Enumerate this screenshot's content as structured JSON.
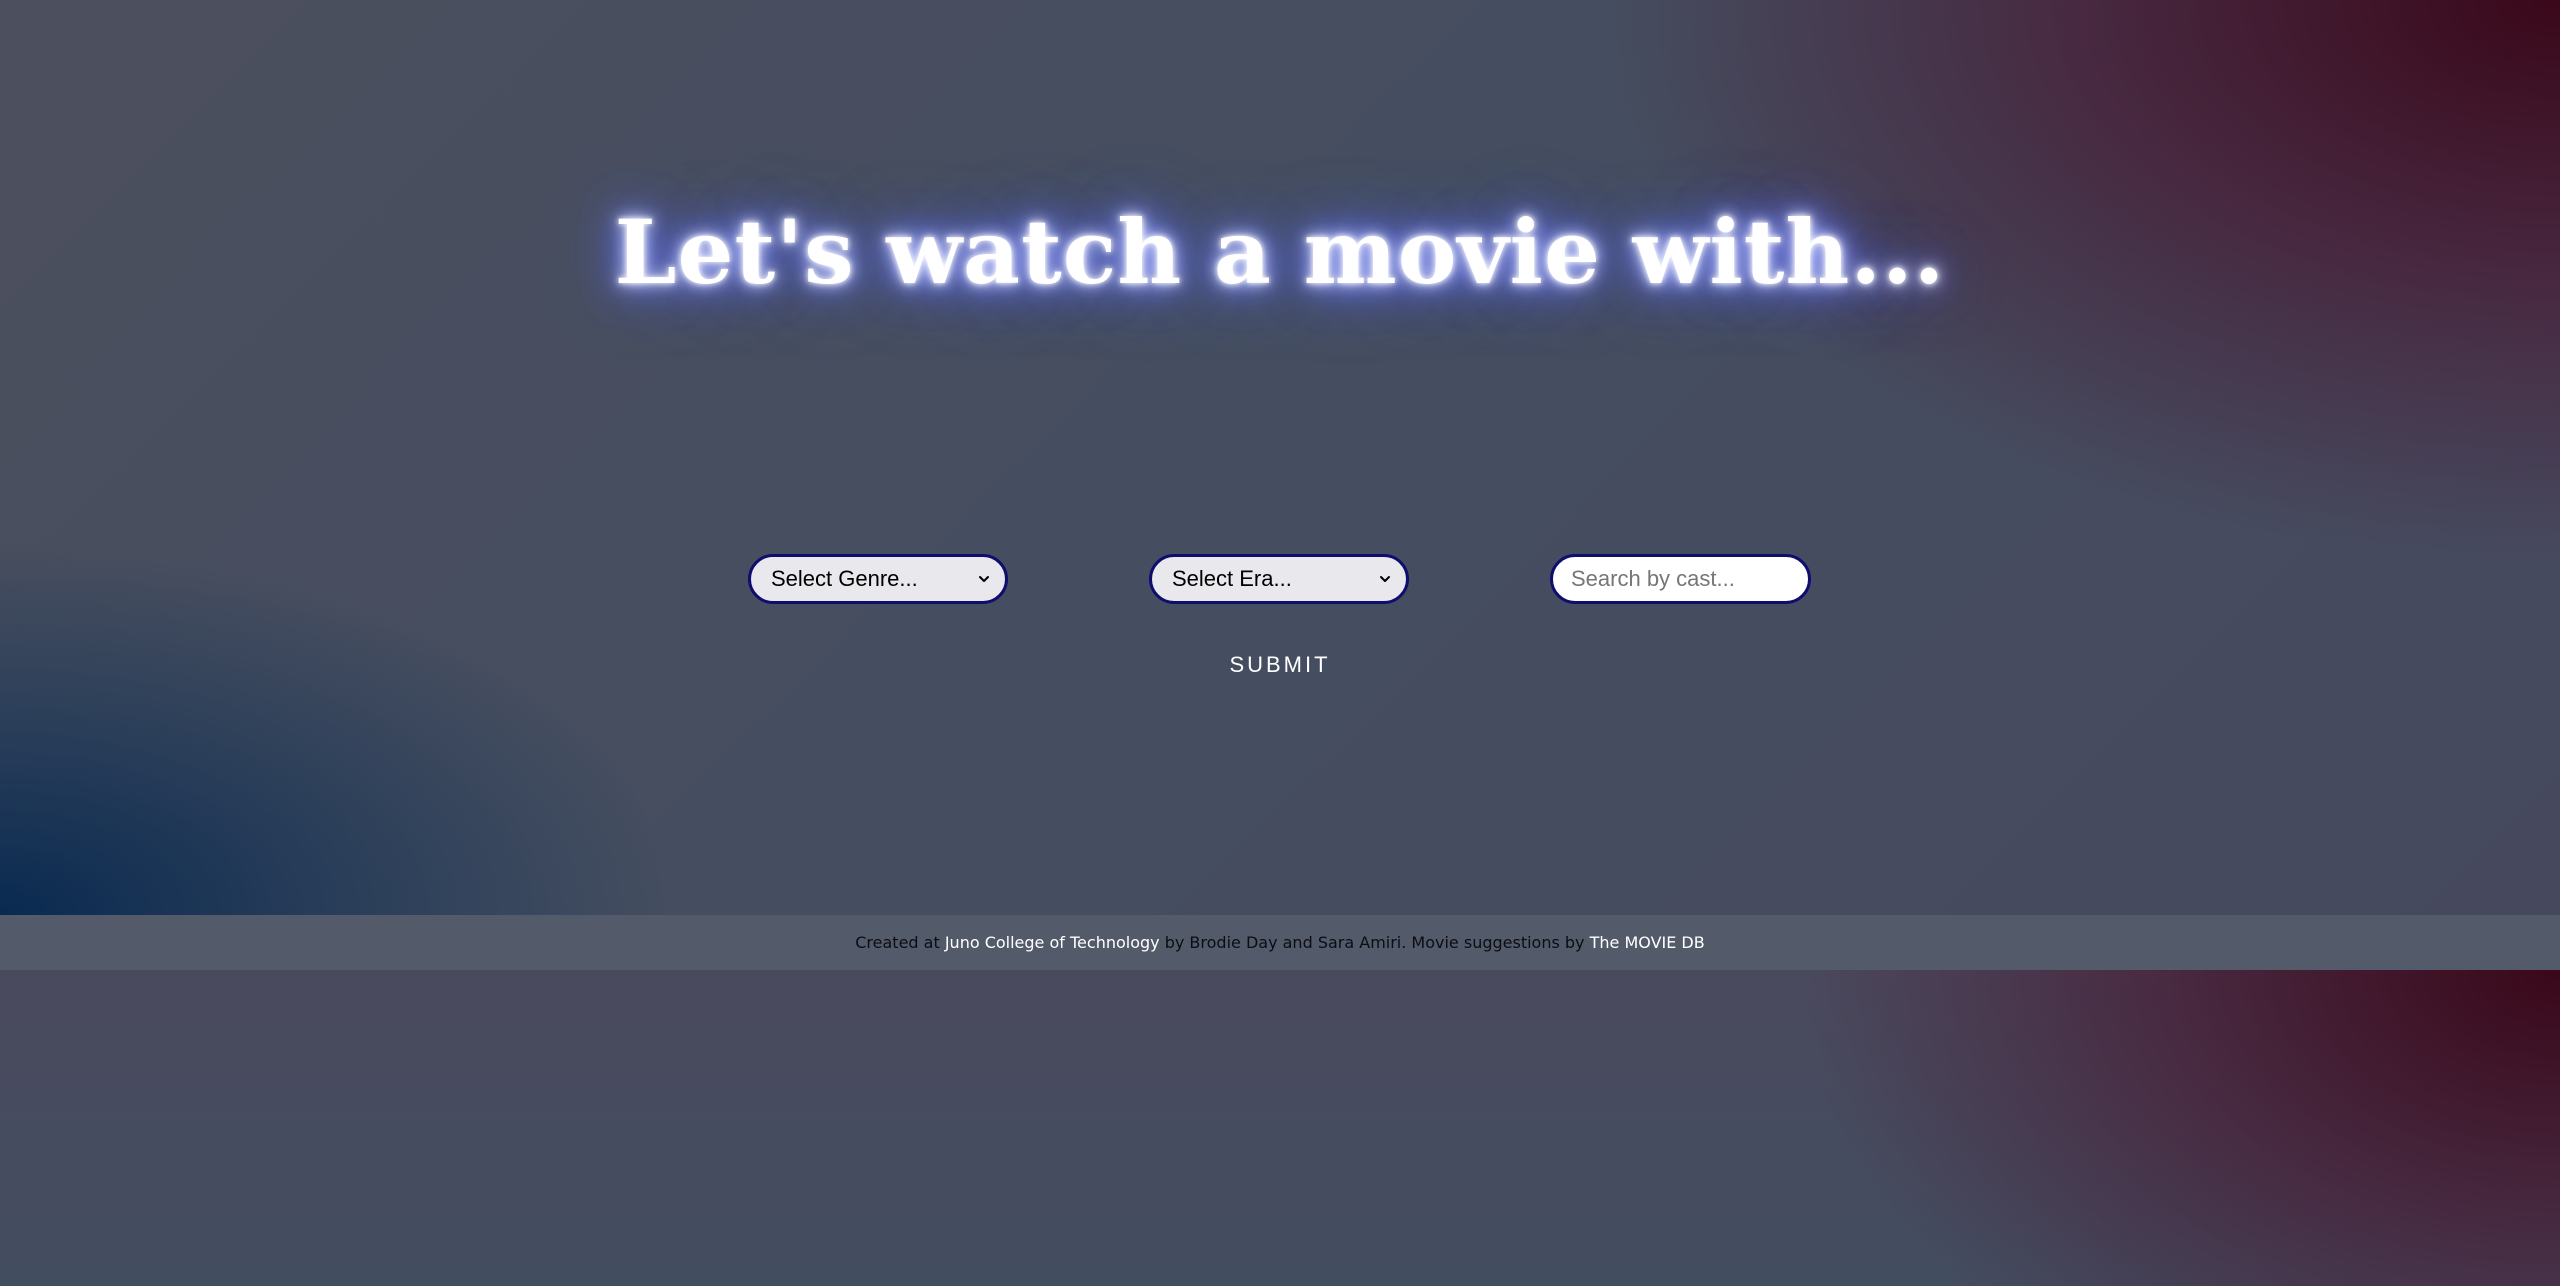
{
  "hero": {
    "title": "Let's watch a movie with..."
  },
  "form": {
    "genre": {
      "selected_label": "Select Genre..."
    },
    "era": {
      "selected_label": "Select Era..."
    },
    "cast_search": {
      "value": "",
      "placeholder": "Search by cast..."
    },
    "submit_label": "Submit"
  },
  "footer": {
    "prefix": "Created at ",
    "school_link": "Juno College of Technology",
    "middle": " by Brodie Day and Sara Amiri. Movie suggestions by ",
    "api_link": "The MOVIE DB"
  },
  "icons": {
    "genre_dropdown": "chevron-down-icon",
    "era_dropdown": "chevron-down-icon"
  },
  "colors": {
    "control_border": "#0e0e6e",
    "title_glow": "#6575ff",
    "footer_bg": "#535b6a"
  }
}
